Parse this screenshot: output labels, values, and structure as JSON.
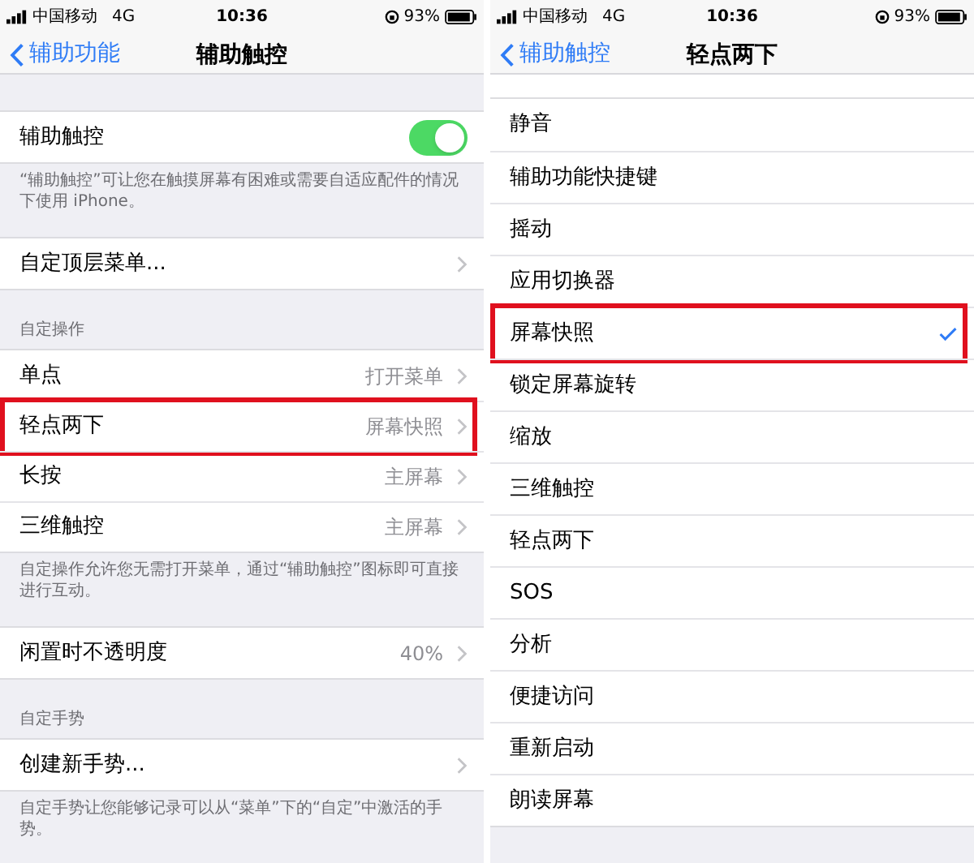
{
  "panels": [
    {
      "status_bar": {
        "carrier": "中国移动",
        "network": "4G",
        "time": "10:36",
        "battery": "93%"
      },
      "nav": {
        "back": "辅助功能",
        "title": "辅助触控"
      },
      "groups": [
        {
          "rows": [
            {
              "kind": "toggle",
              "label": "辅助触控",
              "on": true,
              "annotated": false
            }
          ],
          "footer": "“辅助触控”可让您在触摸屏幕有困难或需要自适应配件的情况下使用 iPhone。"
        },
        {
          "rows": [
            {
              "kind": "link",
              "label": "自定顶层菜单...",
              "annotated": false
            }
          ]
        },
        {
          "header": "自定操作",
          "rows": [
            {
              "kind": "link",
              "label": "单点",
              "value": "打开菜单",
              "annotated": false
            },
            {
              "kind": "link",
              "label": "轻点两下",
              "value": "屏幕快照",
              "annotated": true
            },
            {
              "kind": "link",
              "label": "长按",
              "value": "主屏幕",
              "annotated": false
            },
            {
              "kind": "link",
              "label": "三维触控",
              "value": "主屏幕",
              "annotated": false
            }
          ],
          "footer": "自定操作允许您无需打开菜单，通过“辅助触控”图标即可直接进行互动。"
        },
        {
          "rows": [
            {
              "kind": "link",
              "label": "闲置时不透明度",
              "value": "40%",
              "annotated": false
            }
          ]
        },
        {
          "header": "自定手势",
          "rows": [
            {
              "kind": "link",
              "label": "创建新手势...",
              "annotated": false
            }
          ],
          "footer": "自定手势让您能够记录可以从“菜单”下的“自定”中激活的手势。"
        }
      ]
    },
    {
      "status_bar": {
        "carrier": "中国移动",
        "network": "4G",
        "time": "10:36",
        "battery": "93%"
      },
      "nav": {
        "back": "辅助触控",
        "title": "轻点两下"
      },
      "groups": [
        {
          "rows": [
            {
              "kind": "option",
              "label": "静音",
              "selected": false,
              "annotated": false
            },
            {
              "kind": "option",
              "label": "辅助功能快捷键",
              "selected": false,
              "annotated": false
            },
            {
              "kind": "option",
              "label": "摇动",
              "selected": false,
              "annotated": false
            },
            {
              "kind": "option",
              "label": "应用切换器",
              "selected": false,
              "annotated": false
            },
            {
              "kind": "option",
              "label": "屏幕快照",
              "selected": true,
              "annotated": true
            },
            {
              "kind": "option",
              "label": "锁定屏幕旋转",
              "selected": false,
              "annotated": false
            },
            {
              "kind": "option",
              "label": "缩放",
              "selected": false,
              "annotated": false
            },
            {
              "kind": "option",
              "label": "三维触控",
              "selected": false,
              "annotated": false
            },
            {
              "kind": "option",
              "label": "轻点两下",
              "selected": false,
              "annotated": false
            },
            {
              "kind": "option",
              "label": "SOS",
              "selected": false,
              "annotated": false
            },
            {
              "kind": "option",
              "label": "分析",
              "selected": false,
              "annotated": false
            },
            {
              "kind": "option",
              "label": "便捷访问",
              "selected": false,
              "annotated": false
            },
            {
              "kind": "option",
              "label": "重新启动",
              "selected": false,
              "annotated": false
            },
            {
              "kind": "option",
              "label": "朗读屏幕",
              "selected": false,
              "annotated": false
            }
          ]
        }
      ]
    }
  ]
}
